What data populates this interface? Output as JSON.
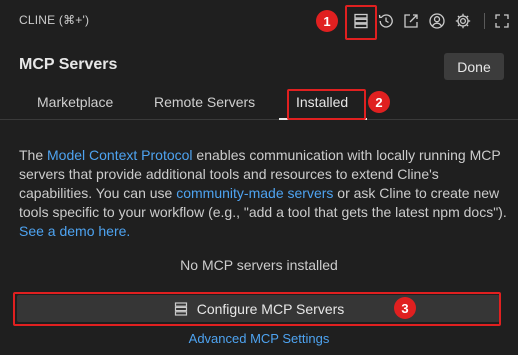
{
  "app": {
    "title": "CLINE (⌘+')"
  },
  "toolbar": {
    "icons": [
      "mcp-servers-icon",
      "history-icon",
      "popout-icon",
      "account-icon",
      "settings-icon",
      "fullscreen-icon"
    ]
  },
  "annotations": {
    "badge1": "1",
    "badge2": "2",
    "badge3": "3",
    "highlight_color": "#e02020"
  },
  "header": {
    "title": "MCP Servers",
    "done_label": "Done"
  },
  "tabs": [
    {
      "label": "Marketplace"
    },
    {
      "label": "Remote Servers"
    },
    {
      "label": "Installed",
      "active": true
    }
  ],
  "description": {
    "part1": "The ",
    "link1": "Model Context Protocol",
    "part2": " enables communication with locally running MCP servers that provide additional tools and resources to extend Cline's capabilities. You can use ",
    "link2": "community-made servers",
    "part3": " or ask Cline to create new tools specific to your workflow (e.g., \"add a tool that gets the latest npm docs\"). ",
    "link3": "See a demo here."
  },
  "main": {
    "empty_message": "No MCP servers installed",
    "configure_label": "Configure MCP Servers",
    "advanced_label": "Advanced MCP Settings"
  },
  "colors": {
    "background": "#1f1f1f",
    "link": "#4ea3f0",
    "button": "#363636"
  }
}
